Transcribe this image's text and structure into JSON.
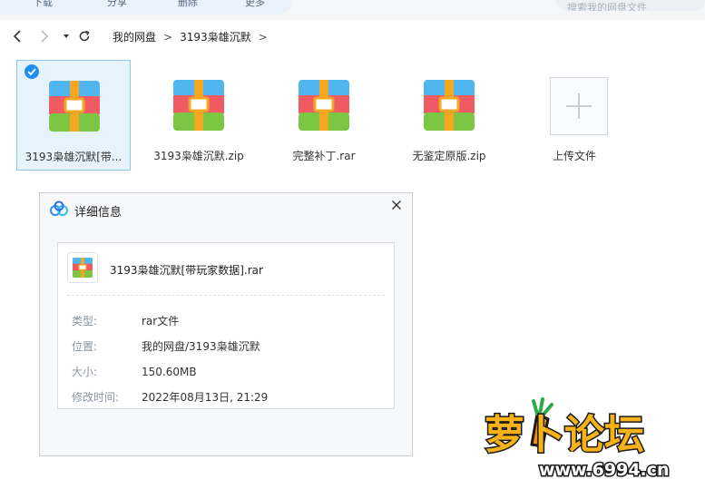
{
  "toolbar": {
    "buttons": [
      "下载",
      "分享",
      "删除",
      "更多"
    ],
    "search_placeholder": "搜索我的网盘文件"
  },
  "navigation": {
    "breadcrumb": [
      "我的网盘",
      "3193枭雄沉默"
    ]
  },
  "files": [
    {
      "name": "3193枭雄沉默[带...",
      "selected": true,
      "icon": "archive-icon"
    },
    {
      "name": "3193枭雄沉默.zip",
      "selected": false,
      "icon": "archive-icon"
    },
    {
      "name": "完整补丁.rar",
      "selected": false,
      "icon": "archive-icon"
    },
    {
      "name": "无鉴定原版.zip",
      "selected": false,
      "icon": "archive-icon"
    },
    {
      "name": "上传文件",
      "selected": false,
      "icon": "plus-icon"
    }
  ],
  "dialog": {
    "title": "详细信息",
    "file_name": "3193枭雄沉默[带玩家数据].rar",
    "fields": [
      {
        "label": "类型:",
        "value": "rar文件"
      },
      {
        "label": "位置:",
        "value": "我的网盘/3193枭雄沉默"
      },
      {
        "label": "大小:",
        "value": "150.60MB"
      },
      {
        "label": "修改时间:",
        "value": "2022年08月13日, 21:29"
      }
    ]
  },
  "watermark": {
    "title": "萝卜论坛",
    "url": "www.6994.cn"
  },
  "colors": {
    "accent": "#1f8ef1",
    "selected_bg": "#e6f3fc",
    "archive_top": "#4fb6ef",
    "archive_mid": "#f05a63",
    "archive_bottom": "#7dc643",
    "archive_band": "#f5a623"
  }
}
